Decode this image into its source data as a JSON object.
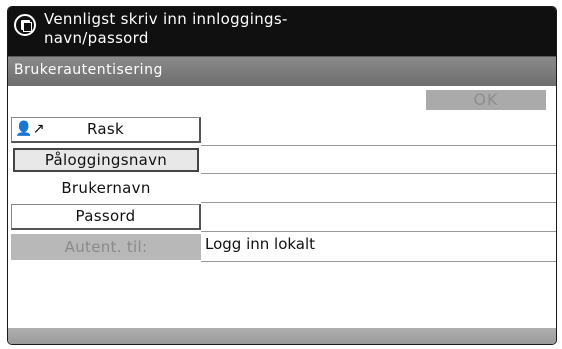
{
  "title": {
    "icon": "copy-document-icon",
    "text": "Vennligst skriv inn innloggings-\nnavn/passord"
  },
  "section": {
    "title": "Brukerautentisering"
  },
  "toolbar": {
    "ok_label": "OK"
  },
  "rows": {
    "rask_label": "Rask",
    "rask_icon": "key-user-icon",
    "login_name_label": "Påloggingsnavn",
    "username_label": "Brukernavn",
    "password_label": "Passord",
    "auth_label": "Autent. til:",
    "auth_value": "Logg inn lokalt"
  }
}
